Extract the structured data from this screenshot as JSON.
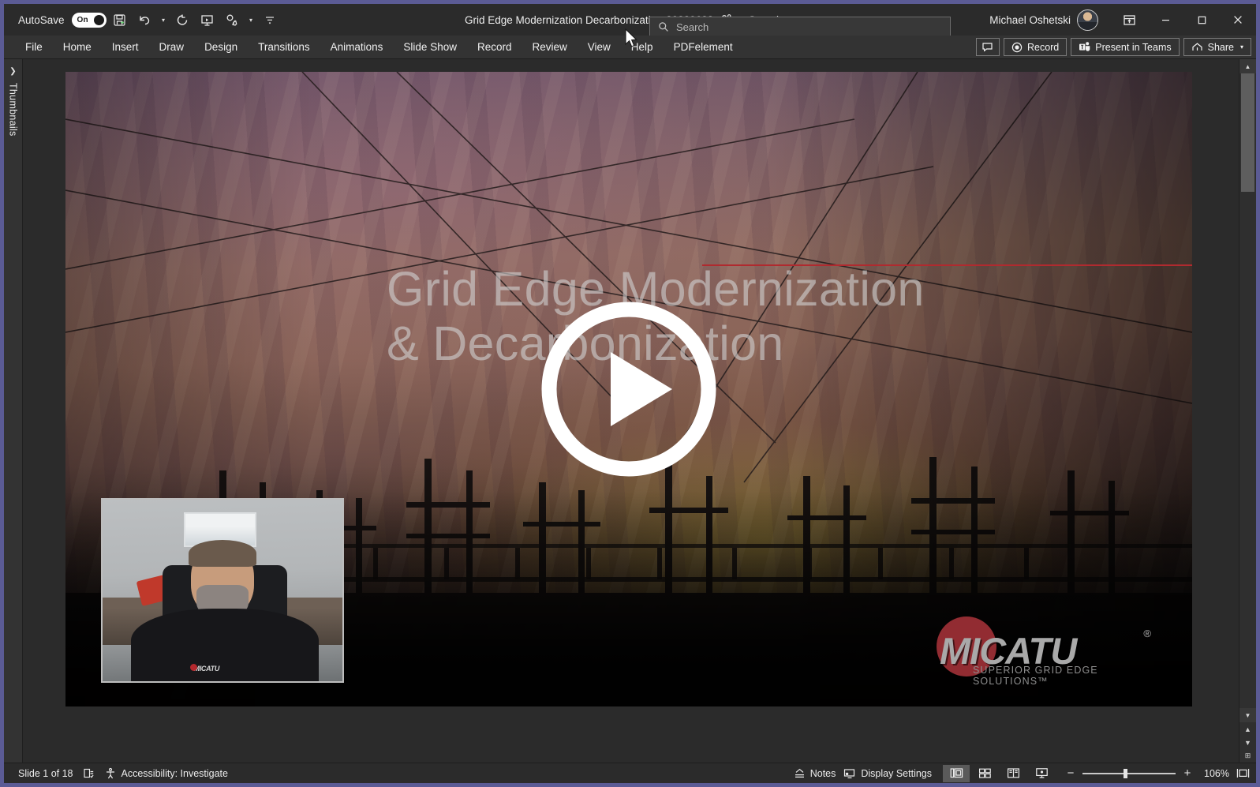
{
  "window": {
    "autosave_label": "AutoSave",
    "autosave_state": "On",
    "document_title": "Grid Edge Modernization Decarbonization-20230622",
    "save_status": "Saved",
    "save_dot": "•",
    "user_name": "Michael Oshetski",
    "minimize_tooltip": "Minimize",
    "maximize_tooltip": "Maximize",
    "close_tooltip": "Close",
    "ribbon_display_tooltip": "Ribbon Display Options"
  },
  "quick_access": [
    {
      "name": "save-icon",
      "label": "Save"
    },
    {
      "name": "undo-icon",
      "label": "Undo"
    },
    {
      "name": "redo-icon",
      "label": "Redo"
    },
    {
      "name": "start-from-beginning-icon",
      "label": "Start From Beginning"
    },
    {
      "name": "touch-mouse-mode-icon",
      "label": "Touch/Mouse Mode"
    },
    {
      "name": "customize-quick-access-toolbar-icon",
      "label": "Customize Quick Access Toolbar"
    }
  ],
  "search": {
    "placeholder": "Search",
    "value": "",
    "icon": "search-icon"
  },
  "ribbon": {
    "tabs": [
      {
        "label": "File"
      },
      {
        "label": "Home"
      },
      {
        "label": "Insert"
      },
      {
        "label": "Draw"
      },
      {
        "label": "Design"
      },
      {
        "label": "Transitions"
      },
      {
        "label": "Animations"
      },
      {
        "label": "Slide Show"
      },
      {
        "label": "Record"
      },
      {
        "label": "Review"
      },
      {
        "label": "View"
      },
      {
        "label": "Help"
      },
      {
        "label": "PDFelement"
      }
    ],
    "actions": {
      "comments_label": "Comments",
      "record_label": "Record",
      "present_in_teams_label": "Present in Teams",
      "share_label": "Share",
      "share_chevron": "▾"
    }
  },
  "sidebar": {
    "expand_chevron": "❯",
    "label": "Thumbnails"
  },
  "slide": {
    "title": "Grid Edge Modernization\n& Decarbonization",
    "logo_word": "MICATU",
    "logo_registered": "®",
    "logo_tagline": "SUPERIOR GRID EDGE SOLUTIONS™",
    "accent_color": "#b02a2f",
    "logo_circle_color": "#9e3036",
    "play_overlay_label": "Play",
    "video_pip_label": "Presenter camera"
  },
  "scroll": {
    "up_arrow": "▲",
    "down_arrow": "▼",
    "previous_slide": "▲",
    "next_slide": "▼",
    "fit_slide": "⊞"
  },
  "status": {
    "slide_counter": "Slide 1 of 18",
    "language_icon": "spell-check-icon",
    "accessibility_label": "Accessibility: Investigate",
    "notes_label": "Notes",
    "display_settings_label": "Display Settings",
    "views": [
      {
        "name": "normal-view",
        "label": "Normal",
        "active": true
      },
      {
        "name": "slide-sorter-view",
        "label": "Slide Sorter",
        "active": false
      },
      {
        "name": "reading-view",
        "label": "Reading View",
        "active": false
      },
      {
        "name": "slide-show-view",
        "label": "Slide Show",
        "active": false
      }
    ],
    "zoom_out": "−",
    "zoom_in": "+",
    "zoom_value": "106%",
    "fit_to_window_label": "Fit slide to current window"
  }
}
